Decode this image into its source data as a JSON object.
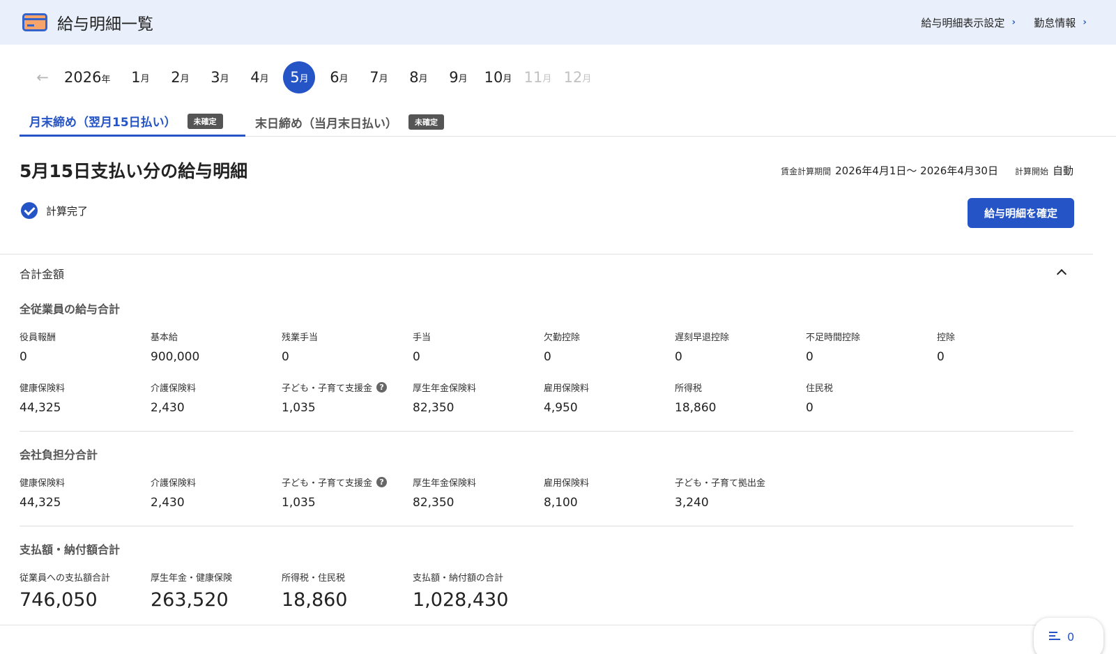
{
  "header": {
    "title": "給与明細一覧",
    "links": [
      "給与明細表示設定",
      "勤怠情報"
    ]
  },
  "months": {
    "year": "2026",
    "year_suffix": "年",
    "month_suffix": "月",
    "items": [
      {
        "n": "1",
        "state": "normal"
      },
      {
        "n": "2",
        "state": "normal"
      },
      {
        "n": "3",
        "state": "normal"
      },
      {
        "n": "4",
        "state": "normal"
      },
      {
        "n": "5",
        "state": "selected"
      },
      {
        "n": "6",
        "state": "normal"
      },
      {
        "n": "7",
        "state": "normal"
      },
      {
        "n": "8",
        "state": "normal"
      },
      {
        "n": "9",
        "state": "normal"
      },
      {
        "n": "10",
        "state": "normal"
      },
      {
        "n": "11",
        "state": "disabled"
      },
      {
        "n": "12",
        "state": "disabled"
      }
    ]
  },
  "tabs": [
    {
      "label": "月末締め（翌月15日払い）",
      "badge": "未確定",
      "active": true
    },
    {
      "label": "末日締め（当月末日払い）",
      "badge": "未確定",
      "active": false
    }
  ],
  "title": "5月15日支払い分の給与明細",
  "period": {
    "label": "賃金計算期間",
    "value": "2026年4月1日〜 2026年4月30日",
    "start_label": "計算開始",
    "start_value": "自動"
  },
  "status": "計算完了",
  "confirm_button": "給与明細を確定",
  "section_title": "合計金額",
  "groups": {
    "employees": {
      "title": "全従業員の給与合計",
      "row1": [
        {
          "label": "役員報酬",
          "value": "0"
        },
        {
          "label": "基本給",
          "value": "900,000"
        },
        {
          "label": "残業手当",
          "value": "0"
        },
        {
          "label": "手当",
          "value": "0"
        },
        {
          "label": "欠勤控除",
          "value": "0"
        },
        {
          "label": "遅刻早退控除",
          "value": "0"
        },
        {
          "label": "不足時間控除",
          "value": "0"
        },
        {
          "label": "控除",
          "value": "0"
        }
      ],
      "row2": [
        {
          "label": "健康保険料",
          "value": "44,325"
        },
        {
          "label": "介護保険料",
          "value": "2,430"
        },
        {
          "label": "子ども・子育て支援金",
          "value": "1,035",
          "help": true
        },
        {
          "label": "厚生年金保険料",
          "value": "82,350"
        },
        {
          "label": "雇用保険料",
          "value": "4,950"
        },
        {
          "label": "所得税",
          "value": "18,860"
        },
        {
          "label": "住民税",
          "value": "0"
        }
      ]
    },
    "company": {
      "title": "会社負担分合計",
      "row1": [
        {
          "label": "健康保険料",
          "value": "44,325"
        },
        {
          "label": "介護保険料",
          "value": "2,430"
        },
        {
          "label": "子ども・子育て支援金",
          "value": "1,035",
          "help": true
        },
        {
          "label": "厚生年金保険料",
          "value": "82,350"
        },
        {
          "label": "雇用保険料",
          "value": "8,100"
        },
        {
          "label": "子ども・子育て拠出金",
          "value": "3,240"
        }
      ]
    },
    "payments": {
      "title": "支払額・納付額合計",
      "row1": [
        {
          "label": "従業員への支払額合計",
          "value": "746,050"
        },
        {
          "label": "厚生年金・健康保険",
          "value": "263,520"
        },
        {
          "label": "所得税・住民税",
          "value": "18,860"
        },
        {
          "label": "支払額・納付額の合計",
          "value": "1,028,430"
        }
      ]
    }
  },
  "help_glyph": "?",
  "fab": {
    "count": "0"
  },
  "colors": {
    "accent": "#2554c7",
    "header_bg": "#e9f0fb",
    "badge_bg": "#555555"
  }
}
